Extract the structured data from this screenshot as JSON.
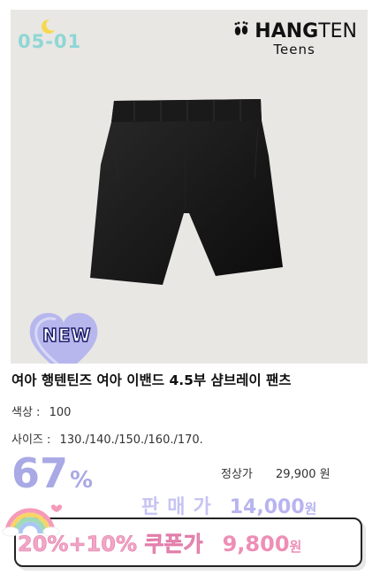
{
  "product_card": {
    "code": "05-01",
    "brand": {
      "main": "HANGTEN",
      "main_bold": "HANG",
      "main_light": "TEN",
      "sub": "Teens"
    },
    "badge": "NEW",
    "title": "여아 행텐틴즈 여아 이밴드 4.5부 샴브레이 팬츠",
    "color": {
      "label": "색상 :",
      "value": "100"
    },
    "size": {
      "label": "사이즈 :",
      "value": "130./140./150./160./170."
    },
    "discount": {
      "number": "67",
      "unit": "%"
    },
    "regular_price": {
      "label": "정상가",
      "value": "29,900",
      "unit": "원"
    },
    "sale_price": {
      "label": "판매가",
      "value": "14,000",
      "unit": "원"
    },
    "coupon_price": {
      "label": "20%+10% 쿠폰가",
      "value": "9,800",
      "unit": "원"
    }
  },
  "colors": {
    "photo_bg": "#e8e7e3",
    "code_color": "#8fd6d6",
    "discount_color": "#a9a9e6",
    "sale_color": "#c7c3f3",
    "coupon_color": "#ee8eb6"
  },
  "icons": [
    "moon-icon",
    "footprint-icon",
    "heart-badge-icon",
    "rainbow-icon",
    "product-shorts-image"
  ]
}
